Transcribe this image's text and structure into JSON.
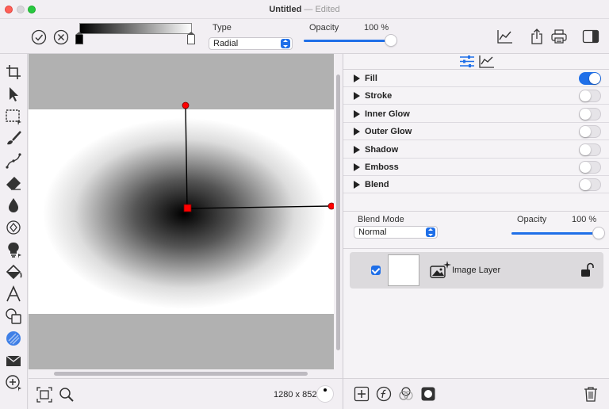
{
  "window": {
    "title": "Untitled",
    "title_sep": "—",
    "status": "Edited"
  },
  "toolbar": {
    "type_label": "Type",
    "type_value": "Radial",
    "opacity_label": "Opacity",
    "opacity_value": "100 %",
    "opacity_fraction": 1.0
  },
  "canvas": {
    "size_text": "1280 x 852"
  },
  "effects": [
    {
      "name": "Fill",
      "enabled": true
    },
    {
      "name": "Stroke",
      "enabled": false
    },
    {
      "name": "Inner Glow",
      "enabled": false
    },
    {
      "name": "Outer Glow",
      "enabled": false
    },
    {
      "name": "Shadow",
      "enabled": false
    },
    {
      "name": "Emboss",
      "enabled": false
    },
    {
      "name": "Blend",
      "enabled": false
    }
  ],
  "blend": {
    "mode_label": "Blend Mode",
    "mode_value": "Normal",
    "opacity_label": "Opacity",
    "opacity_value": "100 %",
    "opacity_fraction": 1.0
  },
  "layers": [
    {
      "name": "Image Layer",
      "visible": true
    }
  ],
  "colors": {
    "accent": "#1f6fe8",
    "handle": "#ff0000"
  }
}
